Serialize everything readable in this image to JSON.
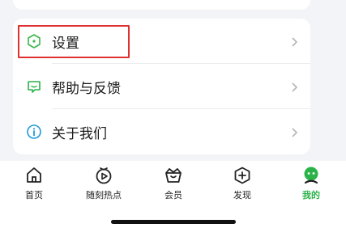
{
  "menu": {
    "items": [
      {
        "label": "设置",
        "icon": "hexagon-icon",
        "color": "#3bb54a"
      },
      {
        "label": "帮助与反馈",
        "icon": "chat-feedback-icon",
        "color": "#2bb34a"
      },
      {
        "label": "关于我们",
        "icon": "info-icon",
        "color": "#1e9bd7"
      }
    ]
  },
  "tabbar": {
    "tabs": [
      {
        "label": "首页",
        "icon": "home-icon",
        "active": false
      },
      {
        "label": "随刻热点",
        "icon": "play-trending-icon",
        "active": false
      },
      {
        "label": "会员",
        "icon": "crown-basket-icon",
        "active": false
      },
      {
        "label": "发现",
        "icon": "plus-hexagon-icon",
        "active": false
      },
      {
        "label": "我的",
        "icon": "profile-avatar-icon",
        "active": true
      }
    ],
    "active_color": "#2bb34a"
  },
  "highlight_color": "#e03131"
}
